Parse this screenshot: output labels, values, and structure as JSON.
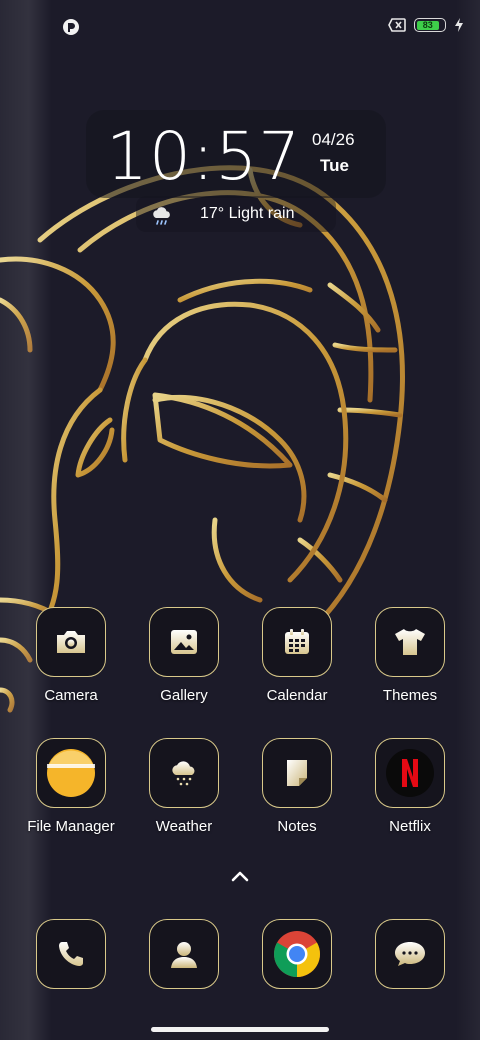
{
  "status_bar": {
    "battery_level": "83",
    "left_icon": "notification-app-icon",
    "right_icons": [
      "no-sim-icon",
      "battery-icon",
      "charging-bolt-icon"
    ]
  },
  "clock_widget": {
    "time": "10:57",
    "date": "04/26",
    "day": "Tue"
  },
  "weather_widget": {
    "icon": "rain-cloud-icon",
    "text": "17° Light rain"
  },
  "apps_row1": [
    {
      "label": "Camera",
      "icon": "camera-icon"
    },
    {
      "label": "Gallery",
      "icon": "image-icon"
    },
    {
      "label": "Calendar",
      "icon": "calendar-icon"
    },
    {
      "label": "Themes",
      "icon": "tshirt-icon"
    }
  ],
  "apps_row2": [
    {
      "label": "File Manager",
      "icon": "folder-icon"
    },
    {
      "label": "Weather",
      "icon": "snow-cloud-icon"
    },
    {
      "label": "Notes",
      "icon": "note-icon"
    },
    {
      "label": "Netflix",
      "icon": "netflix-icon"
    }
  ],
  "dock": [
    {
      "icon": "phone-icon"
    },
    {
      "icon": "contacts-icon"
    },
    {
      "icon": "chrome-icon"
    },
    {
      "icon": "messages-icon"
    }
  ],
  "colors": {
    "background": "#1c1b29",
    "gold": "#d9c98a",
    "wallpaper_line": "#c9a24a",
    "battery_fill": "#3ecf4a",
    "netflix_red": "#e50914"
  }
}
